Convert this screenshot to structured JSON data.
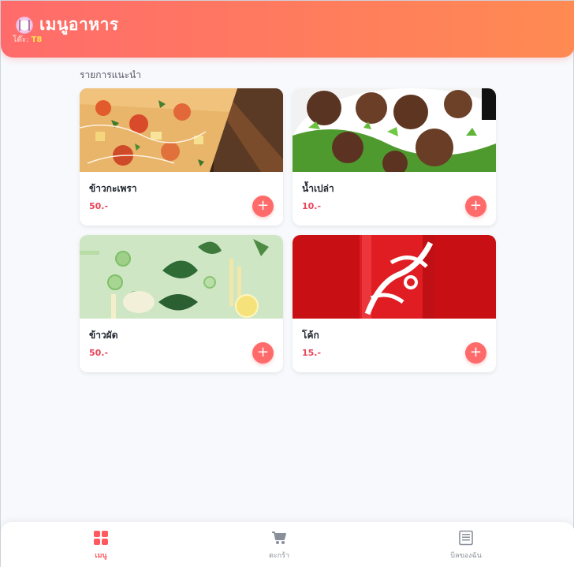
{
  "header": {
    "title": "เมนูอาหาร",
    "table_label": "โต๊ะ:",
    "table_number": "T8"
  },
  "section": {
    "title": "รายการแนะนำ"
  },
  "menu_items": [
    {
      "name": "ข้าวกะเพรา",
      "price": "50.-",
      "image": "pizza-photo"
    },
    {
      "name": "น้ำเปล่า",
      "price": "10.-",
      "image": "meatballs-photo"
    },
    {
      "name": "ข้าวผัด",
      "price": "50.-",
      "image": "vegetables-photo"
    },
    {
      "name": "โค้ก",
      "price": "15.-",
      "image": "coca-cola-can-photo"
    }
  ],
  "add_button": {
    "symbol": "+"
  },
  "bottom_nav": [
    {
      "label": "เมนู",
      "icon": "grid-icon",
      "active": true
    },
    {
      "label": "ตะกร้า",
      "icon": "cart-icon",
      "active": false
    },
    {
      "label": "บิลของฉัน",
      "icon": "receipt-icon",
      "active": false
    }
  ],
  "colors": {
    "accent": "#ff6b6b",
    "accent_gradient_end": "#ff8a52",
    "price": "#e8445a",
    "background": "#f7f9fc"
  }
}
